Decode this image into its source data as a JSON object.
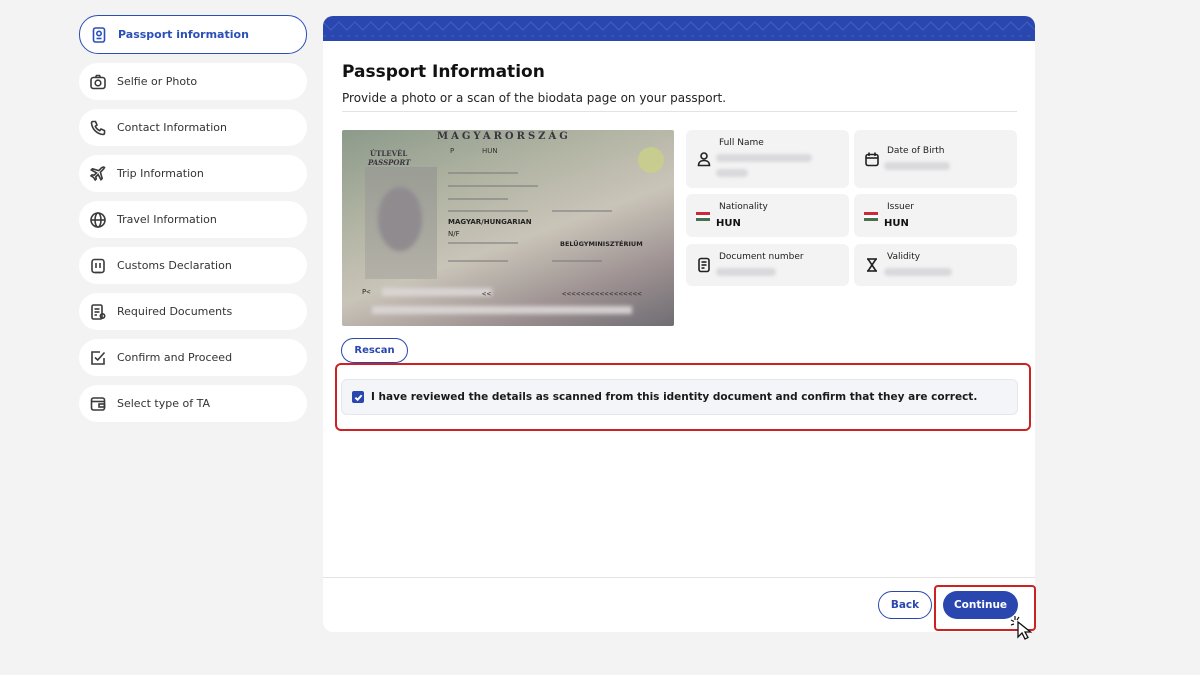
{
  "sidebar": {
    "items": [
      {
        "label": "Passport information",
        "icon": "passport-icon",
        "active": true
      },
      {
        "label": "Selfie or Photo",
        "icon": "camera-icon"
      },
      {
        "label": "Contact Information",
        "icon": "phone-icon"
      },
      {
        "label": "Trip Information",
        "icon": "airplane-icon"
      },
      {
        "label": "Travel Information",
        "icon": "globe-icon"
      },
      {
        "label": "Customs Declaration",
        "icon": "customs-icon"
      },
      {
        "label": "Required Documents",
        "icon": "document-icon"
      },
      {
        "label": "Confirm and Proceed",
        "icon": "checkbox-icon"
      },
      {
        "label": "Select type of TA",
        "icon": "wallet-icon"
      }
    ]
  },
  "main": {
    "title": "Passport Information",
    "subtitle": "Provide a photo or a scan of the biodata page on your passport.",
    "passport_image": {
      "header": "MAGYARORSZÁG",
      "label_hu": "ÚTLEVÉL",
      "label_en": "PASSPORT",
      "type": "P",
      "country": "HUN",
      "nationality": "MAGYAR/HUNGARIAN",
      "sex": "N/F",
      "issuer": "BELÜGYMINISZTÉRIUM",
      "mrz_start": "P<",
      "mrz_mid": "<<",
      "mrz_end": "<<<<<<<<<<<<<<<<<"
    },
    "fields": {
      "full_name": {
        "label": "Full Name",
        "icon": "person-icon"
      },
      "date_of_birth": {
        "label": "Date of Birth",
        "icon": "calendar-icon"
      },
      "nationality": {
        "label": "Nationality",
        "value": "HUN",
        "icon": "hungary-flag-icon"
      },
      "issuer": {
        "label": "Issuer",
        "value": "HUN",
        "icon": "hungary-flag-icon"
      },
      "document_number": {
        "label": "Document number",
        "icon": "document-icon"
      },
      "validity": {
        "label": "Validity",
        "icon": "hourglass-icon"
      }
    },
    "rescan_label": "Rescan",
    "confirm_text": "I have reviewed the details as scanned from this identity document and confirm that they are correct.",
    "confirm_checked": true
  },
  "footer": {
    "back_label": "Back",
    "continue_label": "Continue"
  },
  "colors": {
    "primary": "#2a47b0",
    "highlight": "#cc2222",
    "background": "#f3f3f4"
  }
}
